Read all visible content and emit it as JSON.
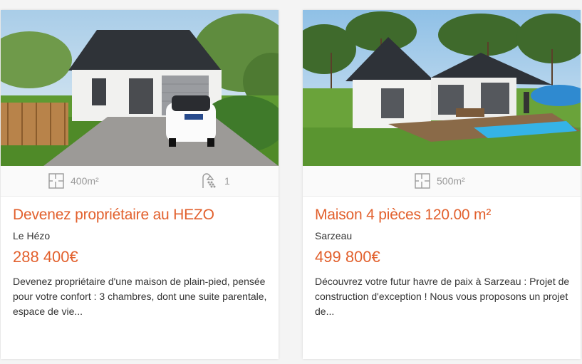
{
  "listings": [
    {
      "surface": "400m²",
      "bathrooms": "1",
      "title": "Devenez propriétaire au HEZO",
      "location": "Le Hézo",
      "price": "288 400€",
      "description": "Devenez propriétaire d'une maison de plain-pied, pensée pour votre confort : 3 chambres, dont une suite parentale, espace de vie..."
    },
    {
      "surface": "500m²",
      "title": "Maison 4 pièces 120.00 m²",
      "location": "Sarzeau",
      "price": "499 800€",
      "description": "Découvrez votre futur havre de paix à Sarzeau : Projet de construction d'exception ! Nous vous proposons un projet de..."
    }
  ],
  "icons": {
    "surface": "floor-plan-icon",
    "bathroom": "shower-icon"
  },
  "colors": {
    "accent": "#e2612e",
    "feature_text": "#9a9a9a"
  }
}
